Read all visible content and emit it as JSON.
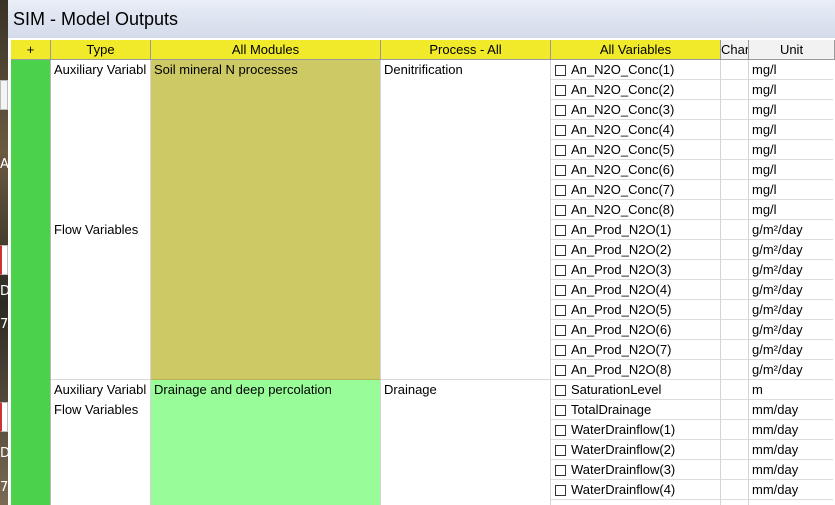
{
  "window": {
    "title": "SIM - Model Outputs"
  },
  "desktop": {
    "glyphs": [
      "A",
      "D",
      "7",
      "D",
      "7"
    ]
  },
  "headers": {
    "expand": "+",
    "type": "Type",
    "modules": "All Modules",
    "process": "Process - All",
    "variables": "All Variables",
    "chart": "Char",
    "unit": "Unit"
  },
  "groups": [
    {
      "types": [
        "Auxiliary Variabl",
        "Flow Variables"
      ],
      "module": "Soil mineral N processes",
      "process": "Denitrification"
    },
    {
      "types": [
        "Auxiliary Variabl",
        "Flow Variables"
      ],
      "module": "Drainage and deep percolation",
      "process": "Drainage"
    }
  ],
  "rows": [
    {
      "variable": "An_N2O_Conc(1)",
      "unit": "mg/l"
    },
    {
      "variable": "An_N2O_Conc(2)",
      "unit": "mg/l"
    },
    {
      "variable": "An_N2O_Conc(3)",
      "unit": "mg/l"
    },
    {
      "variable": "An_N2O_Conc(4)",
      "unit": "mg/l"
    },
    {
      "variable": "An_N2O_Conc(5)",
      "unit": "mg/l"
    },
    {
      "variable": "An_N2O_Conc(6)",
      "unit": "mg/l"
    },
    {
      "variable": "An_N2O_Conc(7)",
      "unit": "mg/l"
    },
    {
      "variable": "An_N2O_Conc(8)",
      "unit": "mg/l"
    },
    {
      "variable": "An_Prod_N2O(1)",
      "unit": "g/m²/day"
    },
    {
      "variable": "An_Prod_N2O(2)",
      "unit": "g/m²/day"
    },
    {
      "variable": "An_Prod_N2O(3)",
      "unit": "g/m²/day"
    },
    {
      "variable": "An_Prod_N2O(4)",
      "unit": "g/m²/day"
    },
    {
      "variable": "An_Prod_N2O(5)",
      "unit": "g/m²/day"
    },
    {
      "variable": "An_Prod_N2O(6)",
      "unit": "g/m²/day"
    },
    {
      "variable": "An_Prod_N2O(7)",
      "unit": "g/m²/day"
    },
    {
      "variable": "An_Prod_N2O(8)",
      "unit": "g/m²/day"
    },
    {
      "variable": "SaturationLevel",
      "unit": "m"
    },
    {
      "variable": "TotalDrainage",
      "unit": "mm/day"
    },
    {
      "variable": "WaterDrainflow(1)",
      "unit": "mm/day"
    },
    {
      "variable": "WaterDrainflow(2)",
      "unit": "mm/day"
    },
    {
      "variable": "WaterDrainflow(3)",
      "unit": "mm/day"
    },
    {
      "variable": "WaterDrainflow(4)",
      "unit": "mm/day"
    }
  ],
  "colors": {
    "header": "#f0ea2a",
    "expand_column": "#4cd14c",
    "module_soil": "#cdc964",
    "module_drainage": "#98fd98"
  }
}
